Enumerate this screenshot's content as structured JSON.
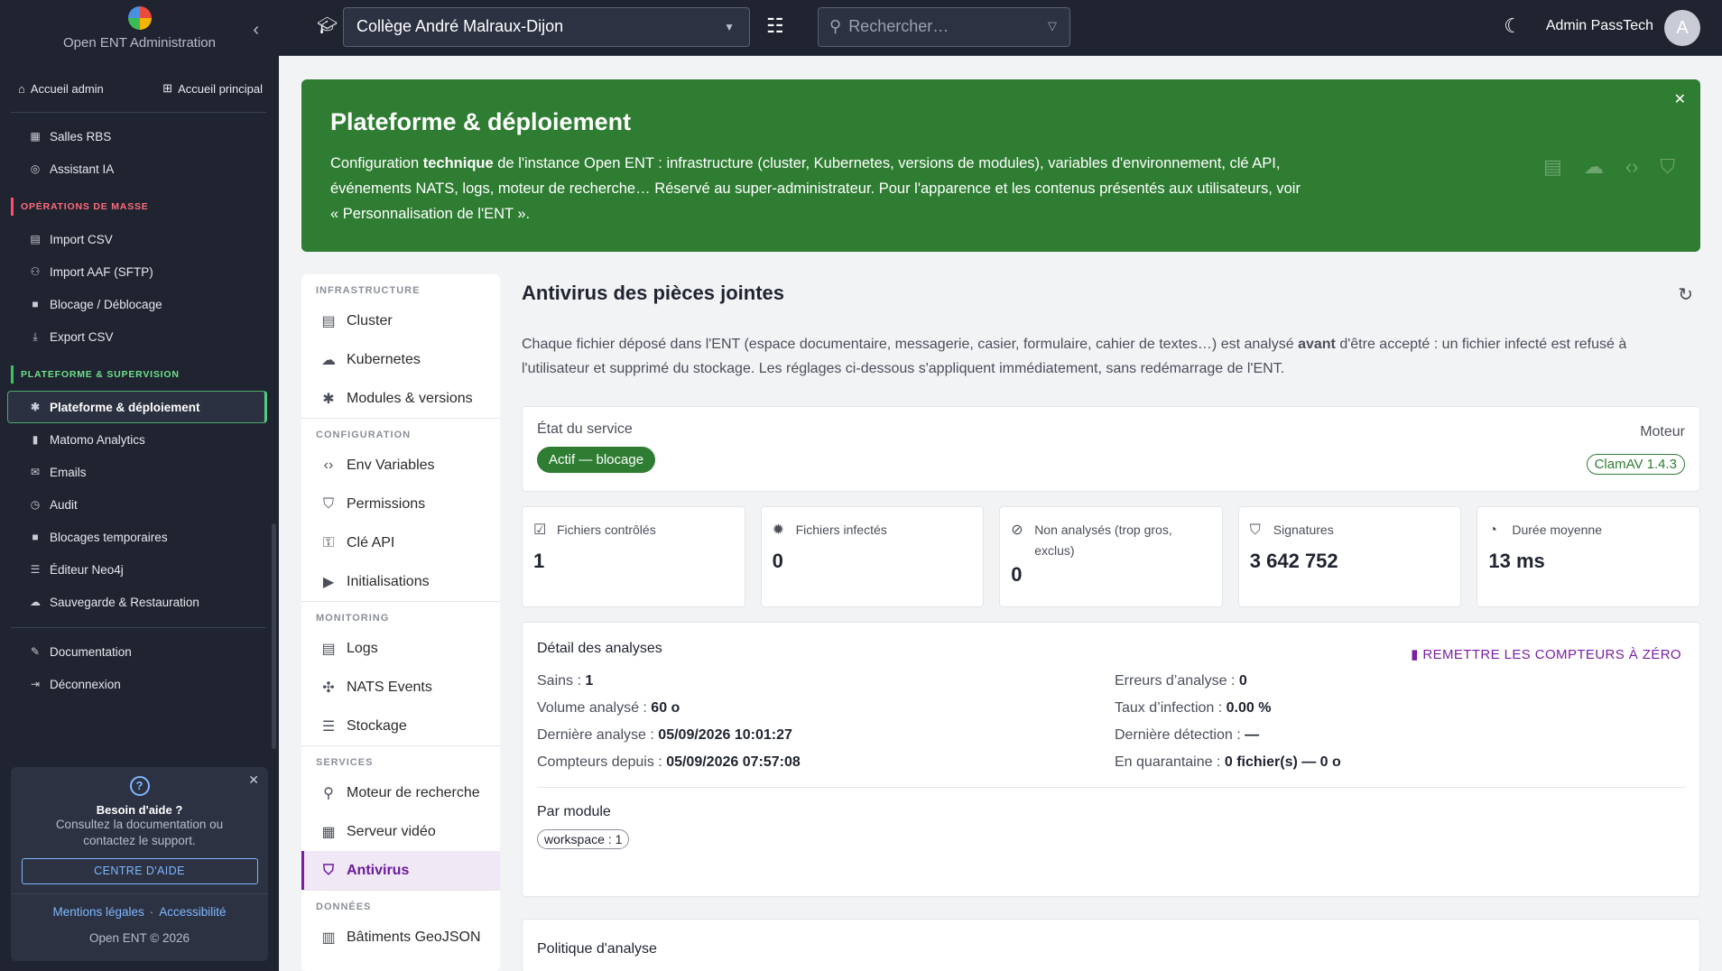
{
  "sidebar": {
    "app_name": "Open ENT Administration",
    "home_admin": "Accueil admin",
    "home_main": "Accueil principal",
    "items_top": [
      {
        "label": "Salles RBS",
        "icon": "building-icon"
      },
      {
        "label": "Assistant IA",
        "icon": "robot-icon"
      }
    ],
    "section_mass": "Opérations de masse",
    "items_mass": [
      {
        "label": "Import CSV",
        "icon": "file-import-icon"
      },
      {
        "label": "Import AAF (SFTP)",
        "icon": "users-import-icon"
      },
      {
        "label": "Blocage / Déblocage",
        "icon": "lock-icon"
      },
      {
        "label": "Export CSV",
        "icon": "download-icon"
      }
    ],
    "section_platform": "Plateforme & supervision",
    "items_platform": [
      {
        "label": "Plateforme & déploiement",
        "icon": "gear-icon"
      },
      {
        "label": "Matomo Analytics",
        "icon": "chart-icon"
      },
      {
        "label": "Emails",
        "icon": "mail-icon"
      },
      {
        "label": "Audit",
        "icon": "history-icon"
      },
      {
        "label": "Blocages temporaires",
        "icon": "lock-clock-icon"
      },
      {
        "label": "Éditeur Neo4j",
        "icon": "list-icon"
      },
      {
        "label": "Sauvegarde & Restauration",
        "icon": "cloud-upload-icon"
      }
    ],
    "items_bottom": [
      {
        "label": "Documentation",
        "icon": "pencil-icon"
      },
      {
        "label": "Déconnexion",
        "icon": "logout-icon"
      }
    ],
    "help": {
      "title": "Besoin d'aide ?",
      "text": "Consultez la documentation ou contactez le support.",
      "button": "CENTRE D'AIDE",
      "legal": "Mentions légales",
      "accessibility": "Accessibilité",
      "copyright": "Open ENT © 2026"
    }
  },
  "topbar": {
    "school": "Collège André Malraux-Dijon",
    "search_placeholder": "Rechercher…",
    "user_name": "Admin PassTech",
    "avatar_initial": "A"
  },
  "banner": {
    "title": "Plateforme & déploiement",
    "text_before": "Configuration ",
    "text_bold": "technique",
    "text_after": " de l'instance Open ENT : infrastructure (cluster, Kubernetes, versions de modules), variables d'environnement, clé API, événements NATS, logs, moteur de recherche… Réservé au super-administrateur. Pour l'apparence et les contenus présentés aux utilisateurs, voir « Personnalisation de l'ENT ».",
    "color": "#2e7d32"
  },
  "subnav": {
    "sections": [
      {
        "title": "Infrastructure",
        "items": [
          "Cluster",
          "Kubernetes",
          "Modules & versions"
        ]
      },
      {
        "title": "Configuration",
        "items": [
          "Env Variables",
          "Permissions",
          "Clé API",
          "Initialisations"
        ]
      },
      {
        "title": "Monitoring",
        "items": [
          "Logs",
          "NATS Events",
          "Stockage"
        ]
      },
      {
        "title": "Services",
        "items": [
          "Moteur de recherche",
          "Serveur vidéo",
          "Antivirus"
        ]
      },
      {
        "title": "Données",
        "items": [
          "Bâtiments GeoJSON"
        ]
      }
    ],
    "active": "Antivirus"
  },
  "main": {
    "title": "Antivirus des pièces jointes",
    "desc_before": "Chaque fichier déposé dans l'ENT (espace documentaire, messagerie, casier, formulaire, cahier de textes…) est analysé ",
    "desc_bold": "avant",
    "desc_after": " d'être accepté : un fichier infecté est refusé à l'utilisateur et supprimé du stockage. Les réglages ci-dessous s'appliquent immédiatement, sans redémarrage de l'ENT.",
    "state_label": "État du service",
    "state_value": "Actif — blocage",
    "engine_label": "Moteur",
    "engine_value": "ClamAV 1.4.3",
    "stats": [
      {
        "label": "Fichiers contrôlés",
        "value": "1",
        "icon": "checklist-icon"
      },
      {
        "label": "Fichiers infectés",
        "value": "0",
        "icon": "virus-icon"
      },
      {
        "label": "Non analysés (trop gros, exclus)",
        "value": "0",
        "icon": "block-icon"
      },
      {
        "label": "Signatures",
        "value": "3 642 752",
        "icon": "shield-icon"
      },
      {
        "label": "Durée moyenne",
        "value": "13 ms",
        "icon": "speedometer-icon"
      }
    ],
    "detail": {
      "title": "Détail des analyses",
      "reset": "REMETTRE LES COMPTEURS À ZÉRO",
      "rows": [
        {
          "label": "Sains : ",
          "value": "1"
        },
        {
          "label": "Erreurs d’analyse : ",
          "value": "0"
        },
        {
          "label": "Volume analysé : ",
          "value": "60 o"
        },
        {
          "label": "Taux d’infection : ",
          "value": "0.00 %"
        },
        {
          "label": "Dernière analyse : ",
          "value": "05/09/2026 10:01:27"
        },
        {
          "label": "Dernière détection : ",
          "value": "—"
        },
        {
          "label": "Compteurs depuis : ",
          "value": "05/09/2026 07:57:08"
        },
        {
          "label": "En quarantaine : ",
          "value": "0 fichier(s) — 0 o"
        }
      ],
      "module_title": "Par module",
      "module_chip": "workspace : 1"
    },
    "policy_title": "Politique d'analyse"
  }
}
